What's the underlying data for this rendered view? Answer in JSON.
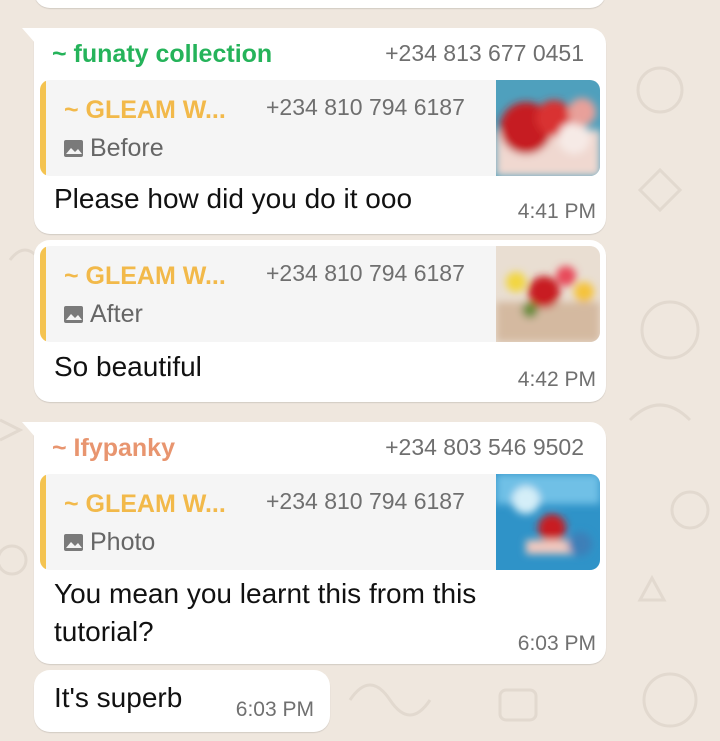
{
  "messages": [
    {
      "sender": "~ funaty collection",
      "sender_phone": "+234 813 677 0451",
      "sender_color": "#25b35a",
      "quote": {
        "name": "~ GLEAM W...",
        "phone": "+234 810 794 6187",
        "type_label": "Before",
        "icon": "image-icon"
      },
      "text": "Please how did you do it ooo",
      "time": "4:41 PM"
    },
    {
      "quote": {
        "name": "~ GLEAM W...",
        "phone": "+234 810 794 6187",
        "type_label": "After",
        "icon": "image-icon"
      },
      "text": "So beautiful",
      "time": "4:42 PM"
    },
    {
      "sender": "~ Ifypanky",
      "sender_phone": "+234 803 546 9502",
      "sender_color": "#e8956f",
      "quote": {
        "name": "~ GLEAM W...",
        "phone": "+234 810 794 6187",
        "type_label": "Photo",
        "icon": "image-icon"
      },
      "text_line1": "You mean you learnt this from this",
      "text_line2": "tutorial?",
      "time": "6:03 PM"
    },
    {
      "text": "It's superb",
      "time": "6:03 PM"
    }
  ],
  "colors": {
    "wallpaper": "#efe7de",
    "bubble": "#ffffff",
    "quote_bar": "#f4c350",
    "quote_name": "#f2b94a"
  }
}
